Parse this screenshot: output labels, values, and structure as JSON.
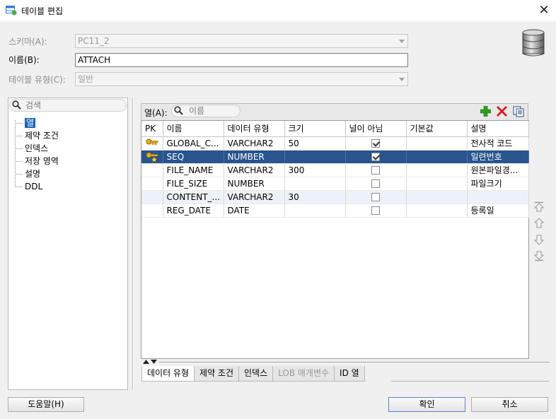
{
  "window": {
    "title": "테이블 편집",
    "close_symbol": "✕"
  },
  "form": {
    "schema_label": "스키마(A):",
    "schema_value": "PC11_2",
    "name_label": "이름(B):",
    "name_value": "ATTACH",
    "table_type_label": "테이블 유형(C):",
    "table_type_value": "일반"
  },
  "sidebar": {
    "search_placeholder": "검색",
    "items": [
      {
        "label": "열",
        "selected": true
      },
      {
        "label": "제약 조건"
      },
      {
        "label": "인덱스"
      },
      {
        "label": "저장 영역"
      },
      {
        "label": "설명"
      },
      {
        "label": "DDL"
      }
    ]
  },
  "columns_panel": {
    "label": "열(A):",
    "search_placeholder": "이름",
    "headers": [
      "PK",
      "이름",
      "데이터 유형",
      "크기",
      "널이 아님",
      "기본값",
      "설명"
    ],
    "rows": [
      {
        "pk": "pk-key",
        "name": "GLOBAL_C...",
        "type": "VARCHAR2",
        "size": "50",
        "not_null": true,
        "default": "",
        "desc": "전사적 코드"
      },
      {
        "pk": "pk-key-star",
        "name": "SEQ",
        "type": "NUMBER",
        "size": "",
        "not_null": true,
        "default": "",
        "desc": "일련번호"
      },
      {
        "pk": "",
        "name": "FILE_NAME",
        "type": "VARCHAR2",
        "size": "300",
        "not_null": false,
        "default": "",
        "desc": "원본파일경..."
      },
      {
        "pk": "",
        "name": "FILE_SIZE",
        "type": "NUMBER",
        "size": "",
        "not_null": false,
        "default": "",
        "desc": "파일크기"
      },
      {
        "pk": "",
        "name": "CONTENT_...",
        "type": "VARCHAR2",
        "size": "30",
        "not_null": false,
        "default": "",
        "desc": ""
      },
      {
        "pk": "",
        "name": "REG_DATE",
        "type": "DATE",
        "size": "",
        "not_null": false,
        "default": "",
        "desc": "등록일"
      }
    ],
    "selected_row": 1
  },
  "bottom_tabs": [
    {
      "label": "데이터 유형",
      "disabled": false
    },
    {
      "label": "제약 조건",
      "disabled": false
    },
    {
      "label": "인덱스",
      "disabled": false
    },
    {
      "label": "LOB 매개변수",
      "disabled": true
    },
    {
      "label": "ID 열",
      "disabled": false
    }
  ],
  "buttons": {
    "help": "도움말(H)",
    "ok": "확인",
    "cancel": "취소"
  },
  "colors": {
    "selection": "#29548d",
    "tree_selection": "#1a65b0",
    "add": "#2e9e1f",
    "delete": "#d32020"
  }
}
